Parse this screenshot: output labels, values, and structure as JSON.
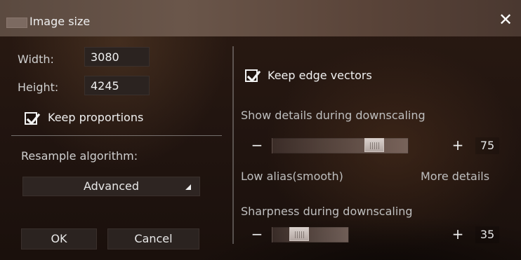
{
  "titlebar": {
    "title": "Image size",
    "icon": "window-icon",
    "close_icon": "close-icon"
  },
  "left_panel": {
    "width_label": "Width:",
    "width_value": "3080",
    "height_label": "Height:",
    "height_value": "4245",
    "keep_proportions": {
      "label": "Keep proportions",
      "checked": true
    },
    "resample_label": "Resample algorithm:",
    "resample_selected": "Advanced",
    "ok_label": "OK",
    "cancel_label": "Cancel"
  },
  "right_panel": {
    "keep_edge_vectors": {
      "label": "Keep edge vectors",
      "checked": true
    },
    "show_details_label": "Show details during downscaling",
    "details_slider": {
      "value": "75",
      "level": 0.75,
      "minus_icon": "minus-icon",
      "plus_icon": "plus-icon"
    },
    "low_alias_label": "Low alias(smooth)",
    "more_details_label": "More details",
    "sharpness_label": "Sharpness during downscaling",
    "sharpness_slider": {
      "value": "35",
      "level": 0.35,
      "minus_icon": "minus-icon",
      "plus_icon": "plus-icon"
    }
  },
  "colors": {
    "text": "#e8e8e8",
    "titlebar": "#5b4a40",
    "field_bg": "#2b2320"
  }
}
